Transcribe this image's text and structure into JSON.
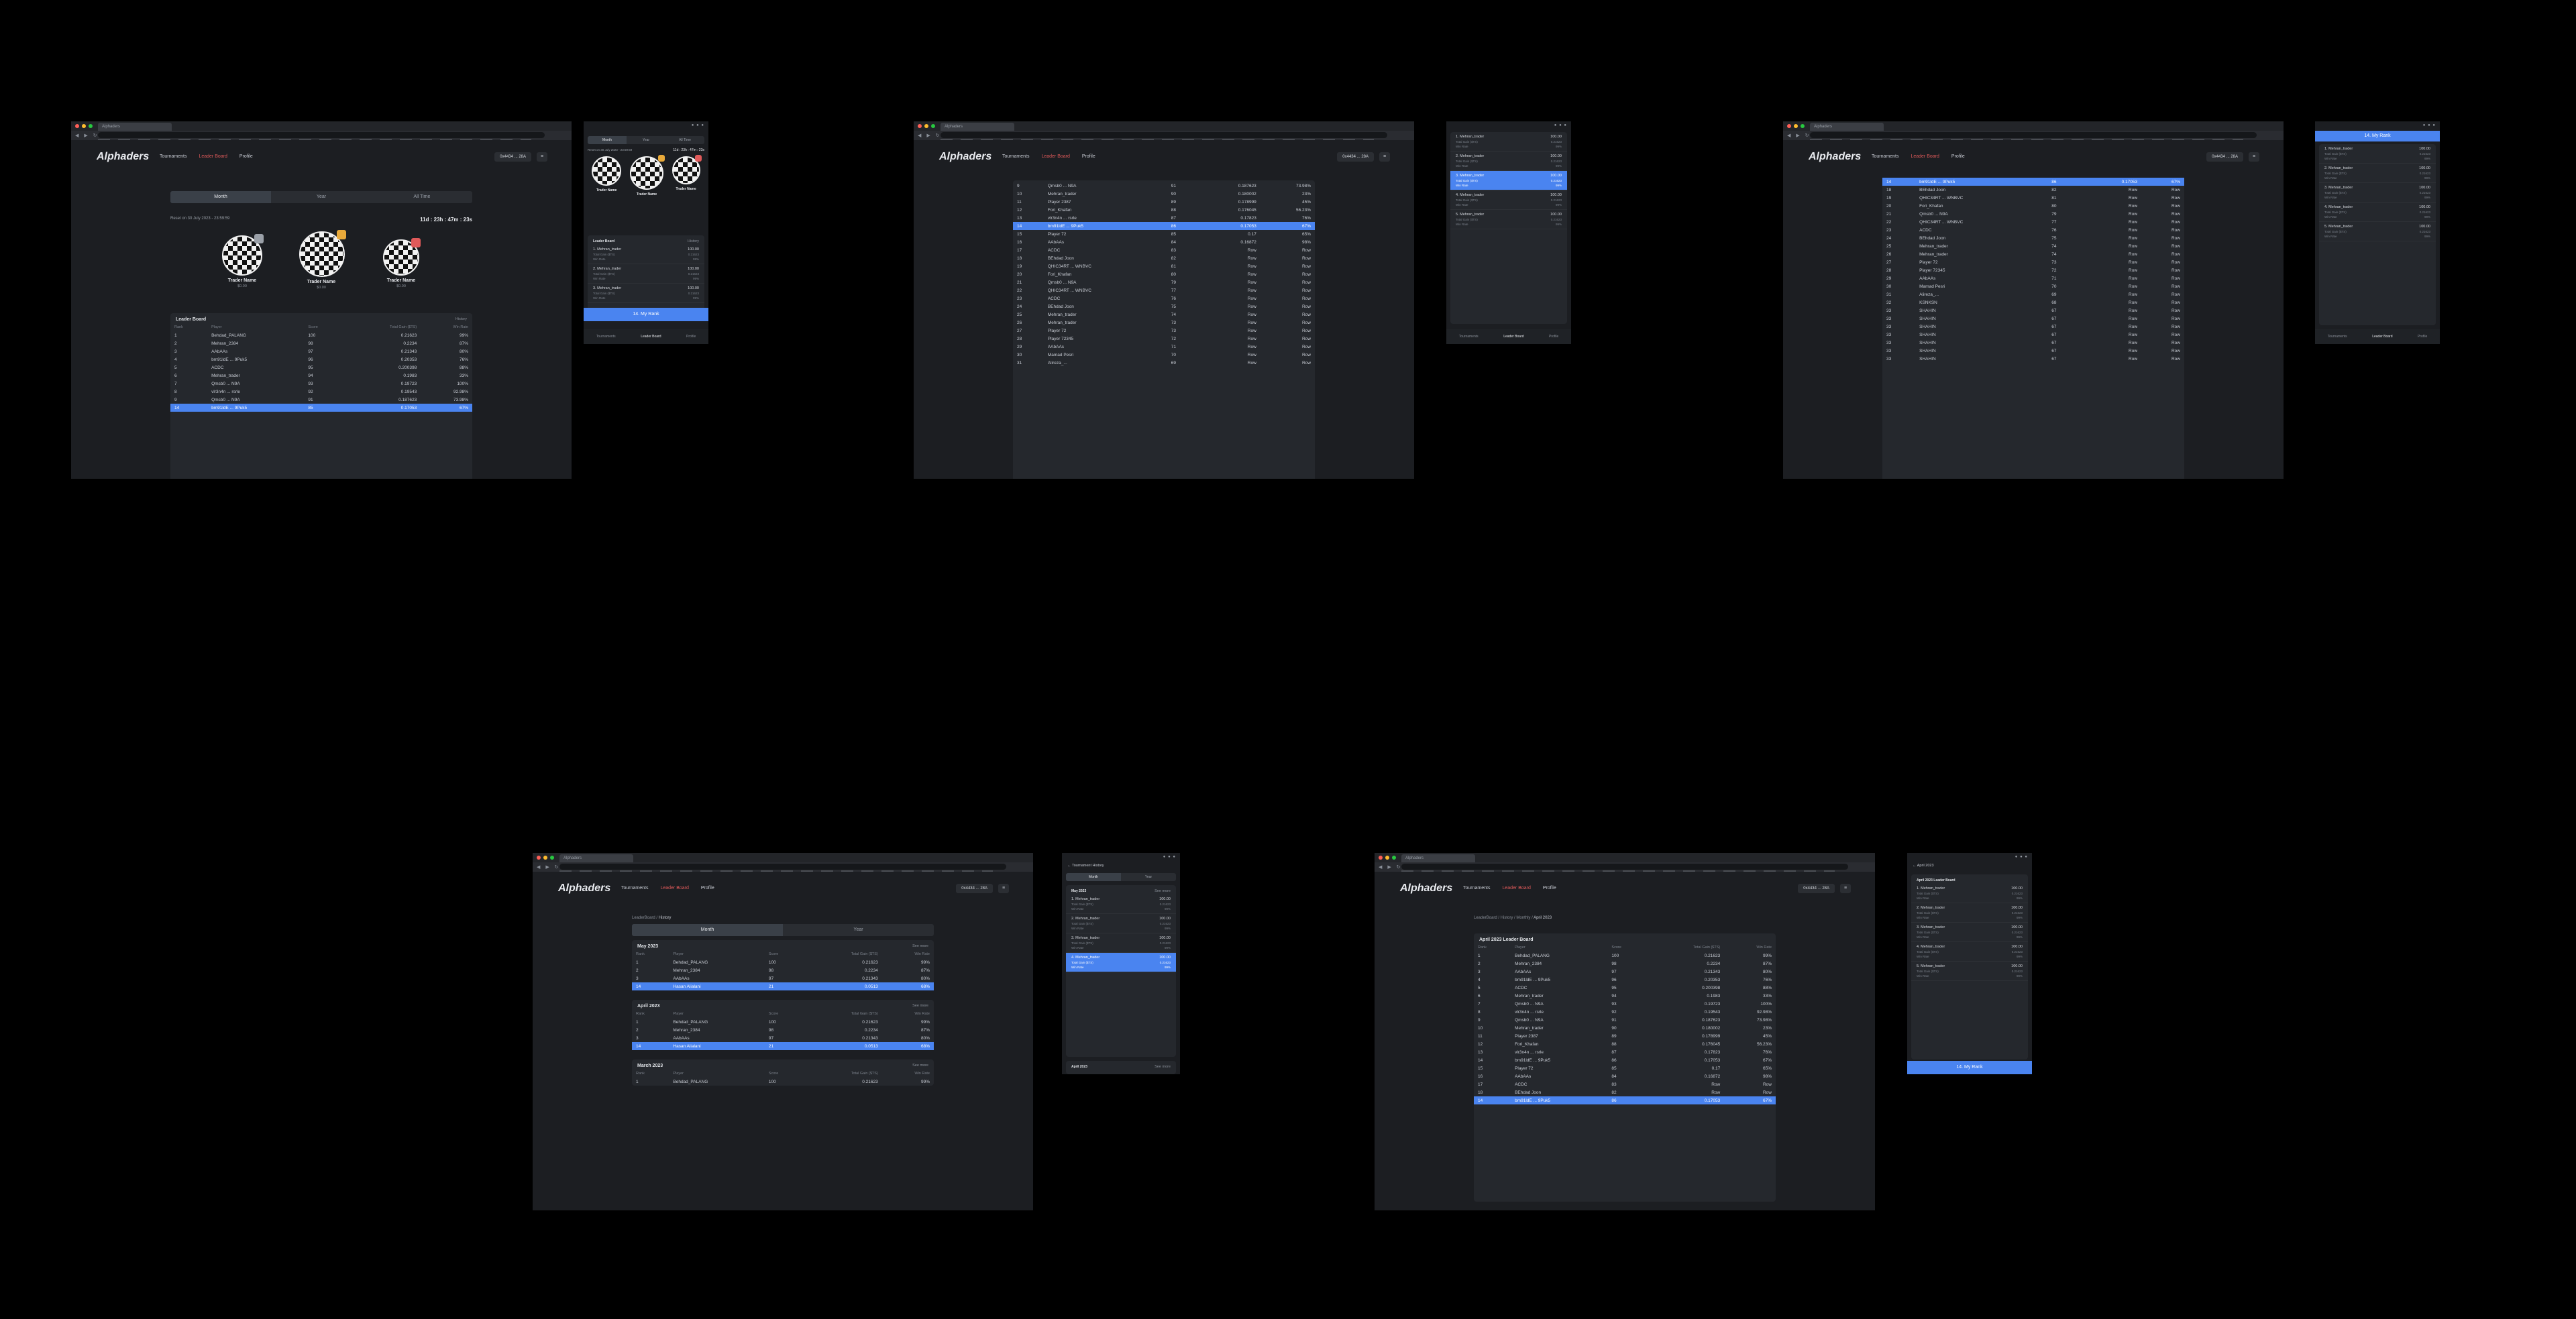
{
  "browser": {
    "tab_title": "Alphaders"
  },
  "app": {
    "logo": "Alphaders",
    "nav": [
      "Tournaments",
      "Leader Board",
      "Profile"
    ],
    "wallet": "0x4434 ... 28A"
  },
  "colors": {
    "accent": "#4a84f0",
    "active_nav": "#e05a5a",
    "bg": "#1c1e22",
    "card": "#25282d"
  },
  "main_view": {
    "tabs": [
      "Month",
      "Year",
      "All Time"
    ],
    "reset_text": "Reset on 30 July 2023 - 23:59:59",
    "countdown": "11d : 23h : 47m : 23s",
    "podium": [
      {
        "name": "Trader Name",
        "sub": "$0.00"
      },
      {
        "name": "Trader Name",
        "sub": "$0.00"
      },
      {
        "name": "Trader Name",
        "sub": "$0.00"
      }
    ],
    "leaderboard_title": "Leader Board",
    "history_label": "History",
    "columns": [
      "Rank",
      "Player",
      "Score",
      "Total Gain ($TS)",
      "Win Rate"
    ],
    "rows": [
      [
        "1",
        "Behdad_PALANG",
        "100",
        "0.21623",
        "99%"
      ],
      [
        "2",
        "Mehran_2384",
        "98",
        "0.2234",
        "87%"
      ],
      [
        "3",
        "AAbAAs",
        "97",
        "0.21343",
        "80%"
      ],
      [
        "4",
        "bm91ldE ... 9Puk5",
        "96",
        "0.20353",
        "76%"
      ],
      [
        "5",
        "ACDC",
        "95",
        "0.200398",
        "88%"
      ],
      [
        "6",
        "Mehran_trader",
        "94",
        "0.1983",
        "33%"
      ],
      [
        "7",
        "Qmsb0 ... N9A",
        "93",
        "0.19723",
        "100%"
      ],
      [
        "8",
        "vlr3n4n ... rsrle",
        "92",
        "0.19543",
        "92.98%"
      ],
      [
        "9",
        "Qmsb0 ... N9A",
        "91",
        "0.187623",
        "73.98%"
      ]
    ],
    "my_row": [
      "14",
      "bm91ldE ... 9Puk5",
      "85",
      "0.17053",
      "67%"
    ]
  },
  "scroll_view": {
    "rows": [
      [
        "9",
        "Qmsb0 ... N9A",
        "91",
        "0.187623",
        "73.98%"
      ],
      [
        "10",
        "Mehran_trader",
        "90",
        "0.180002",
        "23%"
      ],
      [
        "11",
        "Player 2387",
        "89",
        "0.178999",
        "45%"
      ],
      [
        "12",
        "Fori_Khafan",
        "88",
        "0.176045",
        "56.23%"
      ],
      [
        "13",
        "vlr3n4n ... rsrle",
        "87",
        "0.17823",
        "76%"
      ],
      [
        "14",
        "bm91ldE ... 9Puk5",
        "86",
        "0.17053",
        "67%"
      ],
      [
        "15",
        "Player 72",
        "85",
        "0.17",
        "65%"
      ],
      [
        "16",
        "AAbAAs",
        "84",
        "0.16872",
        "98%"
      ],
      [
        "17",
        "ACDC",
        "83",
        "Row",
        "Row"
      ],
      [
        "18",
        "BEhdad Joon",
        "82",
        "Row",
        "Row"
      ],
      [
        "19",
        "QHIC34RT ... WNBVC",
        "81",
        "Row",
        "Row"
      ],
      [
        "20",
        "Fori_Khafan",
        "80",
        "Row",
        "Row"
      ],
      [
        "21",
        "Qmsb0 ... N9A",
        "79",
        "Row",
        "Row"
      ],
      [
        "22",
        "QHIC34RT ... WNBVC",
        "77",
        "Row",
        "Row"
      ],
      [
        "23",
        "ACDC",
        "76",
        "Row",
        "Row"
      ],
      [
        "24",
        "BEhdad Joon",
        "75",
        "Row",
        "Row"
      ],
      [
        "25",
        "Mehran_trader",
        "74",
        "Row",
        "Row"
      ],
      [
        "26",
        "Mehran_trader",
        "73",
        "Row",
        "Row"
      ],
      [
        "27",
        "Player 72",
        "73",
        "Row",
        "Row"
      ],
      [
        "28",
        "Player 72345",
        "72",
        "Row",
        "Row"
      ],
      [
        "29",
        "AAbAAs",
        "71",
        "Row",
        "Row"
      ],
      [
        "30",
        "Mamad Pesri",
        "70",
        "Row",
        "Row"
      ],
      [
        "31",
        "Alireza_...",
        "69",
        "Row",
        "Row"
      ]
    ],
    "highlight_index": 5
  },
  "bottom_view": {
    "rows": [
      [
        "14",
        "bm91ldE ... 9Puk5",
        "86",
        "0.17053",
        "67%"
      ],
      [
        "18",
        "BEhdad Joon",
        "82",
        "Row",
        "Row"
      ],
      [
        "19",
        "QHIC34RT ... WNBVC",
        "81",
        "Row",
        "Row"
      ],
      [
        "20",
        "Fori_Khafan",
        "80",
        "Row",
        "Row"
      ],
      [
        "21",
        "Qmsb0 ... N9A",
        "79",
        "Row",
        "Row"
      ],
      [
        "22",
        "QHIC34RT ... WNBVC",
        "77",
        "Row",
        "Row"
      ],
      [
        "23",
        "ACDC",
        "76",
        "Row",
        "Row"
      ],
      [
        "24",
        "BEhdad Joon",
        "75",
        "Row",
        "Row"
      ],
      [
        "25",
        "Mehran_trader",
        "74",
        "Row",
        "Row"
      ],
      [
        "26",
        "Mehran_trader",
        "74",
        "Row",
        "Row"
      ],
      [
        "27",
        "Player 72",
        "73",
        "Row",
        "Row"
      ],
      [
        "28",
        "Player 72345",
        "72",
        "Row",
        "Row"
      ],
      [
        "29",
        "AAbAAs",
        "71",
        "Row",
        "Row"
      ],
      [
        "30",
        "Mamad Pesri",
        "70",
        "Row",
        "Row"
      ],
      [
        "31",
        "Alireza_...",
        "69",
        "Row",
        "Row"
      ],
      [
        "32",
        "KSNKSN",
        "68",
        "Row",
        "Row"
      ],
      [
        "33",
        "SHAHIN",
        "67",
        "Row",
        "Row"
      ],
      [
        "33",
        "SHAHIN",
        "67",
        "Row",
        "Row"
      ],
      [
        "33",
        "SHAHIN",
        "67",
        "Row",
        "Row"
      ],
      [
        "33",
        "SHAHIN",
        "67",
        "Row",
        "Row"
      ],
      [
        "33",
        "SHAHIN",
        "67",
        "Row",
        "Row"
      ],
      [
        "33",
        "SHAHIN",
        "67",
        "Row",
        "Row"
      ],
      [
        "33",
        "SHAHIN",
        "67",
        "Row",
        "Row"
      ]
    ]
  },
  "mobile": {
    "status": "● ● ●",
    "tabs": [
      "Month",
      "Year",
      "All Time"
    ],
    "reset_text": "Reset on 30 July 2023 - 23:59:59",
    "countdown": "11d : 23h : 47m : 23s",
    "leaderboard_title": "Leader Board",
    "history_label": "History",
    "rows": [
      {
        "name": "1. Mehran_trader",
        "value": "100.00",
        "sub1": "Total Gain ($TS)",
        "sub1v": "0.21623",
        "sub2": "Win Rate",
        "sub2v": "99%"
      },
      {
        "name": "2. Mehran_trader",
        "value": "100.00",
        "sub1": "Total Gain ($TS)",
        "sub1v": "0.21623",
        "sub2": "Win Rate",
        "sub2v": "99%"
      },
      {
        "name": "3. Mehran_trader",
        "value": "100.00",
        "sub1": "Total Gain ($TS)",
        "sub1v": "0.21623",
        "sub2": "Win Rate",
        "sub2v": "99%"
      },
      {
        "name": "4. Mehran_trader",
        "value": "100.00",
        "sub1": "Total Gain ($TS)",
        "sub1v": "0.21623",
        "sub2": "Win Rate",
        "sub2v": "99%"
      },
      {
        "name": "5. Mehran_trader",
        "value": "100.00",
        "sub1": "Total Gain ($TS)",
        "sub1v": "0.21623",
        "sub2": "Win Rate",
        "sub2v": "99%"
      }
    ],
    "my_rank_label": "14. My Rank",
    "bottom_nav": [
      "Tournaments",
      "Leader Board",
      "Profile"
    ]
  },
  "history_view": {
    "breadcrumb": [
      "LeaderBoard",
      "History"
    ],
    "tabs": [
      "Month",
      "Year"
    ],
    "see_all": "See more",
    "columns": [
      "Rank",
      "Player",
      "Score",
      "Total Gain ($TS)",
      "Win Rate"
    ],
    "months": [
      {
        "title": "May 2023",
        "rows": [
          [
            "1",
            "Behdad_PALANG",
            "100",
            "0.21623",
            "99%"
          ],
          [
            "2",
            "Mehran_2384",
            "98",
            "0.2234",
            "87%"
          ],
          [
            "3",
            "AAbAAs",
            "97",
            "0.21343",
            "80%"
          ]
        ],
        "my_row": [
          "14",
          "Hasan Alialani",
          "21",
          "0.0513",
          "68%"
        ]
      },
      {
        "title": "April 2023",
        "rows": [
          [
            "1",
            "Behdad_PALANG",
            "100",
            "0.21623",
            "99%"
          ],
          [
            "2",
            "Mehran_2384",
            "98",
            "0.2234",
            "87%"
          ],
          [
            "3",
            "AAbAAs",
            "97",
            "0.21343",
            "80%"
          ]
        ],
        "my_row": [
          "14",
          "Hasan Alialani",
          "21",
          "0.0513",
          "68%"
        ]
      },
      {
        "title": "March 2023",
        "rows": [
          [
            "1",
            "Behdad_PALANG",
            "100",
            "0.21623",
            "99%"
          ]
        ],
        "my_row": null
      }
    ],
    "mobile_title": "Tournament History"
  },
  "april_view": {
    "breadcrumb": [
      "LeaderBoard",
      "History",
      "Monthly",
      "April 2023"
    ],
    "title": "April 2023 Leader Board",
    "columns": [
      "Rank",
      "Player",
      "Score",
      "Total Gain ($TS)",
      "Win Rate"
    ],
    "rows": [
      [
        "1",
        "Behdad_PALANG",
        "100",
        "0.21623",
        "99%"
      ],
      [
        "2",
        "Mehran_2384",
        "98",
        "0.2234",
        "87%"
      ],
      [
        "3",
        "AAbAAs",
        "97",
        "0.21343",
        "80%"
      ],
      [
        "4",
        "bm91ldE ... 9Puk5",
        "96",
        "0.20353",
        "76%"
      ],
      [
        "5",
        "ACDC",
        "95",
        "0.200398",
        "88%"
      ],
      [
        "6",
        "Mehran_trader",
        "94",
        "0.1983",
        "33%"
      ],
      [
        "7",
        "Qmsb0 ... N9A",
        "93",
        "0.19723",
        "100%"
      ],
      [
        "8",
        "vlr3n4n ... rsrle",
        "92",
        "0.19543",
        "92.98%"
      ],
      [
        "9",
        "Qmsb0 ... N9A",
        "91",
        "0.187623",
        "73.98%"
      ],
      [
        "10",
        "Mehran_trader",
        "90",
        "0.180002",
        "23%"
      ],
      [
        "11",
        "Player 2387",
        "89",
        "0.178999",
        "45%"
      ],
      [
        "12",
        "Fori_Khafan",
        "88",
        "0.176045",
        "56.23%"
      ],
      [
        "13",
        "vlr3n4n ... rsrle",
        "87",
        "0.17823",
        "76%"
      ],
      [
        "14",
        "bm91ldE ... 9Puk5",
        "86",
        "0.17053",
        "67%"
      ],
      [
        "15",
        "Player 72",
        "85",
        "0.17",
        "65%"
      ],
      [
        "16",
        "AAbAAs",
        "84",
        "0.16872",
        "98%"
      ],
      [
        "17",
        "ACDC",
        "83",
        "Row",
        "Row"
      ],
      [
        "18",
        "BEhdad Joon",
        "82",
        "Row",
        "Row"
      ]
    ],
    "my_row": [
      "14",
      "bm91ldE ... 9Puk5",
      "86",
      "0.17053",
      "67%"
    ],
    "mobile_title": "April 2023",
    "mobile_subtitle": "April 2023 Leader Board"
  }
}
